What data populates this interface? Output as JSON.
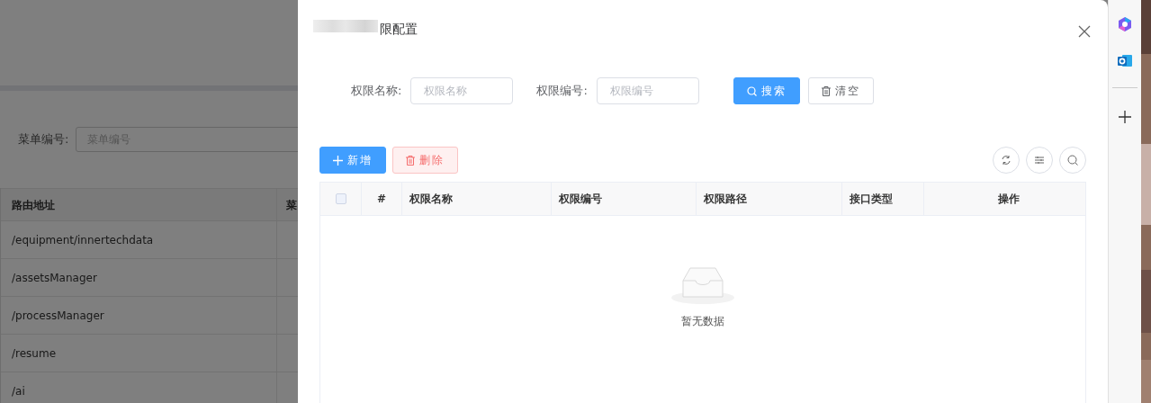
{
  "background_page": {
    "filter": {
      "label": "菜单编号:",
      "placeholder": "菜单编号"
    },
    "table": {
      "columns": [
        "路由地址",
        "菜"
      ],
      "rows": [
        "/equipment/innertechdata",
        "/assetsManager",
        "/processManager",
        "/resume",
        "/ai"
      ]
    }
  },
  "drawer": {
    "title": "限配置",
    "search_fields": [
      {
        "label": "权限名称:",
        "placeholder": "权限名称"
      },
      {
        "label": "权限编号:",
        "placeholder": "权限编号"
      }
    ],
    "search_buttons": [
      {
        "label": "搜索",
        "kind": "search"
      },
      {
        "label": "清空",
        "kind": "clear"
      }
    ],
    "toolbar_buttons": [
      {
        "label": "新增",
        "kind": "add"
      },
      {
        "label": "删除",
        "kind": "delete"
      }
    ],
    "table": {
      "select_all_checked": false,
      "columns": [
        "#",
        "权限名称",
        "权限编号",
        "权限路径",
        "接口类型",
        "操作"
      ],
      "empty_text": "暂无数据"
    }
  }
}
